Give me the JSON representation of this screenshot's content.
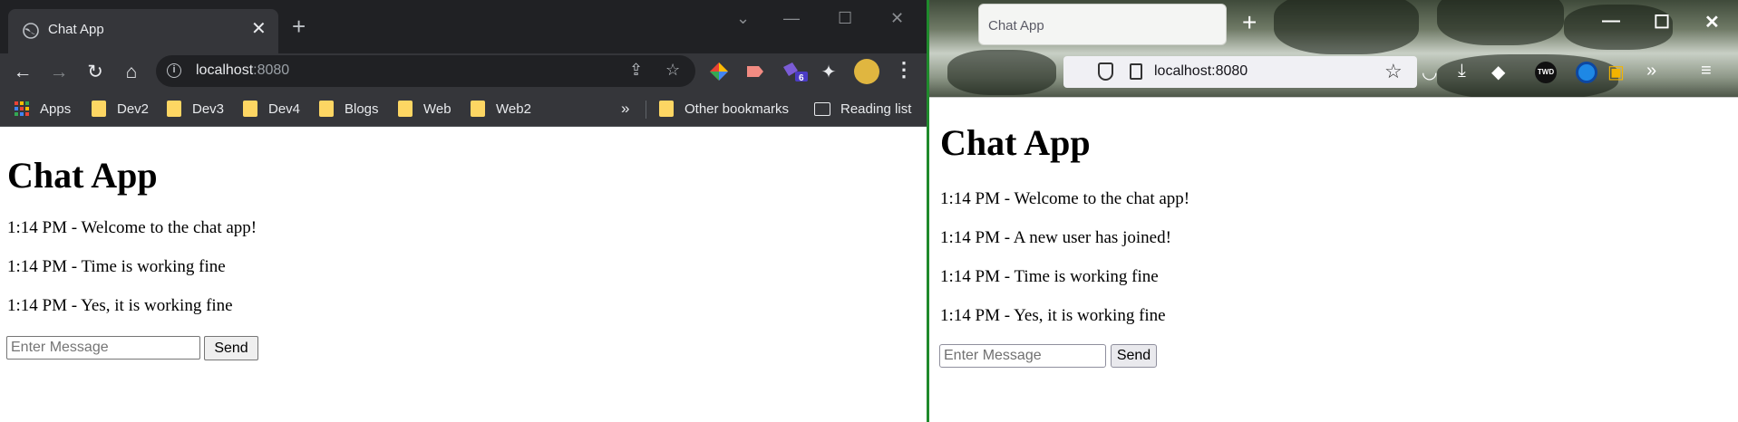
{
  "chrome": {
    "tab_title": "Chat App",
    "url_host": "localhost",
    "url_port": ":8080",
    "extension_badge": "6",
    "bookmarks": [
      "Apps",
      "Dev2",
      "Dev3",
      "Dev4",
      "Blogs",
      "Web",
      "Web2"
    ],
    "other_bookmarks": "Other bookmarks",
    "reading_list": "Reading list",
    "page": {
      "heading": "Chat App",
      "messages": [
        "1:14 PM - Welcome to the chat app!",
        "1:14 PM - Time is working fine",
        "1:14 PM - Yes, it is working fine"
      ],
      "input_placeholder": "Enter Message",
      "send_label": "Send"
    }
  },
  "firefox": {
    "tab_title": "Chat App",
    "url": "localhost:8080",
    "ext_label": "TWD",
    "page": {
      "heading": "Chat App",
      "messages": [
        "1:14 PM - Welcome to the chat app!",
        "1:14 PM - A new user has joined!",
        "1:14 PM - Time is working fine",
        "1:14 PM - Yes, it is working fine"
      ],
      "input_placeholder": "Enter Message",
      "send_label": "Send"
    }
  },
  "colors": {
    "chrome_frame": "#202124",
    "chrome_toolbar": "#35363a",
    "folder_yellow": "#fdd663",
    "desktop_green": "#1f8a2c"
  }
}
